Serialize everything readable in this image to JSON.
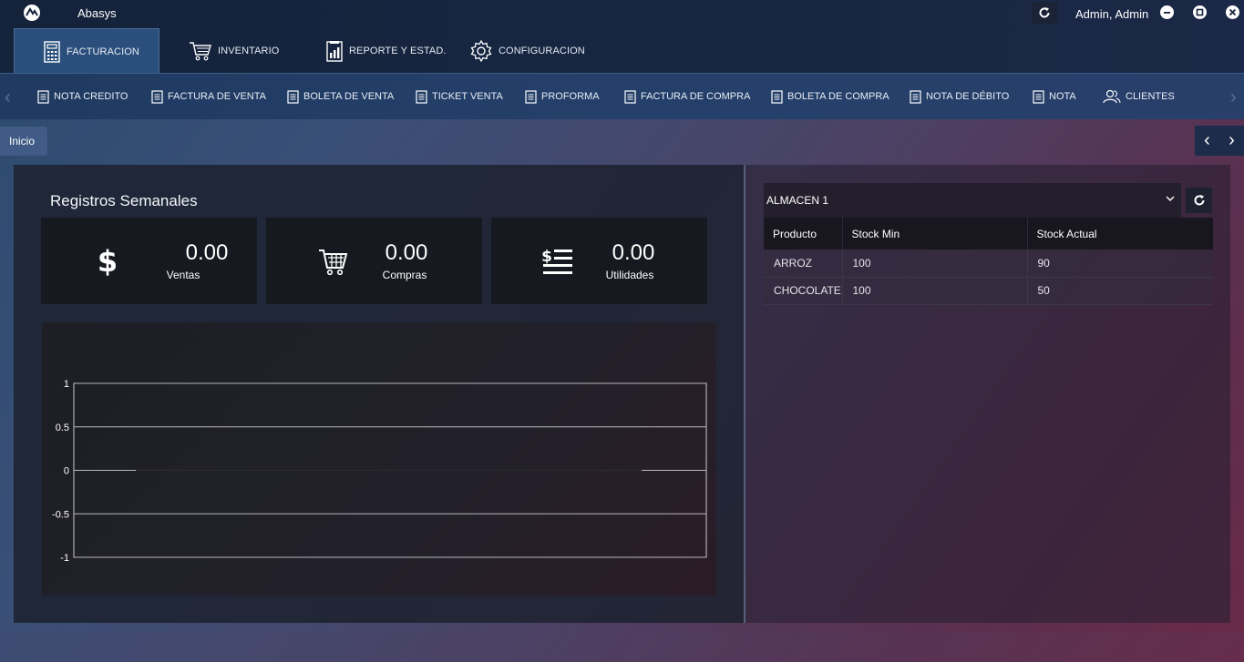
{
  "app": {
    "title": "Abasys",
    "user": "Admin, Admin"
  },
  "menu_tabs": [
    {
      "label": "FACTURACION",
      "icon": "calculator-icon",
      "active": true
    },
    {
      "label": "INVENTARIO",
      "icon": "cart-icon"
    },
    {
      "label": "REPORTE Y ESTAD.",
      "icon": "report-icon"
    },
    {
      "label": "CONFIGURACION",
      "icon": "gear-icon"
    }
  ],
  "sub_toolbar": [
    {
      "label": "NOTA CREDITO",
      "icon": "document-icon"
    },
    {
      "label": "FACTURA DE VENTA",
      "icon": "document-icon"
    },
    {
      "label": "BOLETA DE VENTA",
      "icon": "document-icon"
    },
    {
      "label": "TICKET VENTA",
      "icon": "document-icon"
    },
    {
      "label": "PROFORMA",
      "icon": "document-icon"
    },
    {
      "label": "FACTURA DE COMPRA",
      "icon": "document-icon"
    },
    {
      "label": "BOLETA DE COMPRA",
      "icon": "document-icon"
    },
    {
      "label": "NOTA DE DÉBITO",
      "icon": "document-icon"
    },
    {
      "label": "NOTA",
      "icon": "document-icon"
    },
    {
      "label": "CLIENTES",
      "icon": "users-icon"
    }
  ],
  "page_tab": {
    "label": "Inicio"
  },
  "dashboard": {
    "title": "Registros Semanales",
    "stats": [
      {
        "value": "0.00",
        "label": "Ventas",
        "icon": "dollar-icon"
      },
      {
        "value": "0.00",
        "label": "Compras",
        "icon": "cart-icon"
      },
      {
        "value": "0.00",
        "label": "Utilidades",
        "icon": "money-list-icon"
      }
    ]
  },
  "chart_data": {
    "type": "line",
    "title": "",
    "xlabel": "",
    "ylabel": "",
    "ylim": [
      -1,
      1
    ],
    "yticks": [
      "1",
      "0.5",
      "0",
      "-0.5",
      "-1"
    ],
    "series": [
      {
        "values": [
          0,
          0,
          0,
          0,
          0,
          0,
          0
        ]
      }
    ],
    "grid": true
  },
  "stock_panel": {
    "warehouse": "ALMACEN 1",
    "columns": [
      "Producto",
      "Stock Min",
      "Stock Actual"
    ],
    "rows": [
      [
        "ARROZ",
        "100",
        "90"
      ],
      [
        "CHOCOLATE",
        "100",
        "50"
      ]
    ]
  }
}
